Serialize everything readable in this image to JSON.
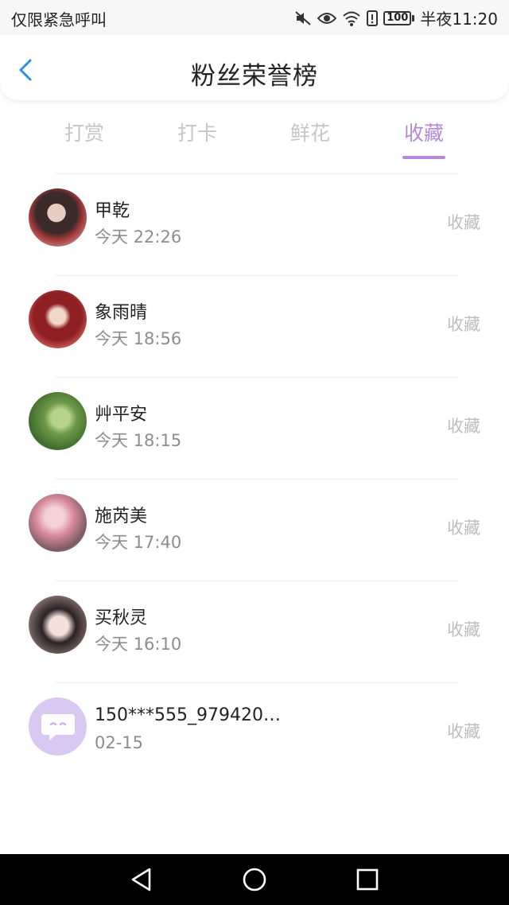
{
  "status_bar": {
    "left_text": "仅限紧急呼叫",
    "battery": "100",
    "time": "半夜11:20",
    "icons": [
      "mute-icon",
      "eye-icon",
      "wifi-icon",
      "alert-icon",
      "battery-icon"
    ]
  },
  "header": {
    "title": "粉丝荣誉榜",
    "back_icon": "chevron-left-icon"
  },
  "tabs": {
    "items": [
      {
        "label": "打赏"
      },
      {
        "label": "打卡"
      },
      {
        "label": "鲜花"
      },
      {
        "label": "收藏"
      }
    ],
    "active_index": 3
  },
  "fans": [
    {
      "name": "甲乾",
      "time": "今天 22:26",
      "action": "收藏"
    },
    {
      "name": "象雨晴",
      "time": "今天 18:56",
      "action": "收藏"
    },
    {
      "name": "艸平安",
      "time": "今天 18:15",
      "action": "收藏"
    },
    {
      "name": "施芮美",
      "time": "今天 17:40",
      "action": "收藏"
    },
    {
      "name": "买秋灵",
      "time": "今天 16:10",
      "action": "收藏"
    },
    {
      "name": "150***555_9794200...",
      "time": "02-15",
      "action": "收藏"
    }
  ],
  "nav_bar": {
    "icons": [
      "back-triangle-icon",
      "home-circle-icon",
      "recents-square-icon"
    ]
  },
  "colors": {
    "accent": "#b48ad6",
    "back_arrow": "#2f8ee8",
    "inactive_tab": "#c6c6c6",
    "secondary_text": "#8d8d8d"
  }
}
